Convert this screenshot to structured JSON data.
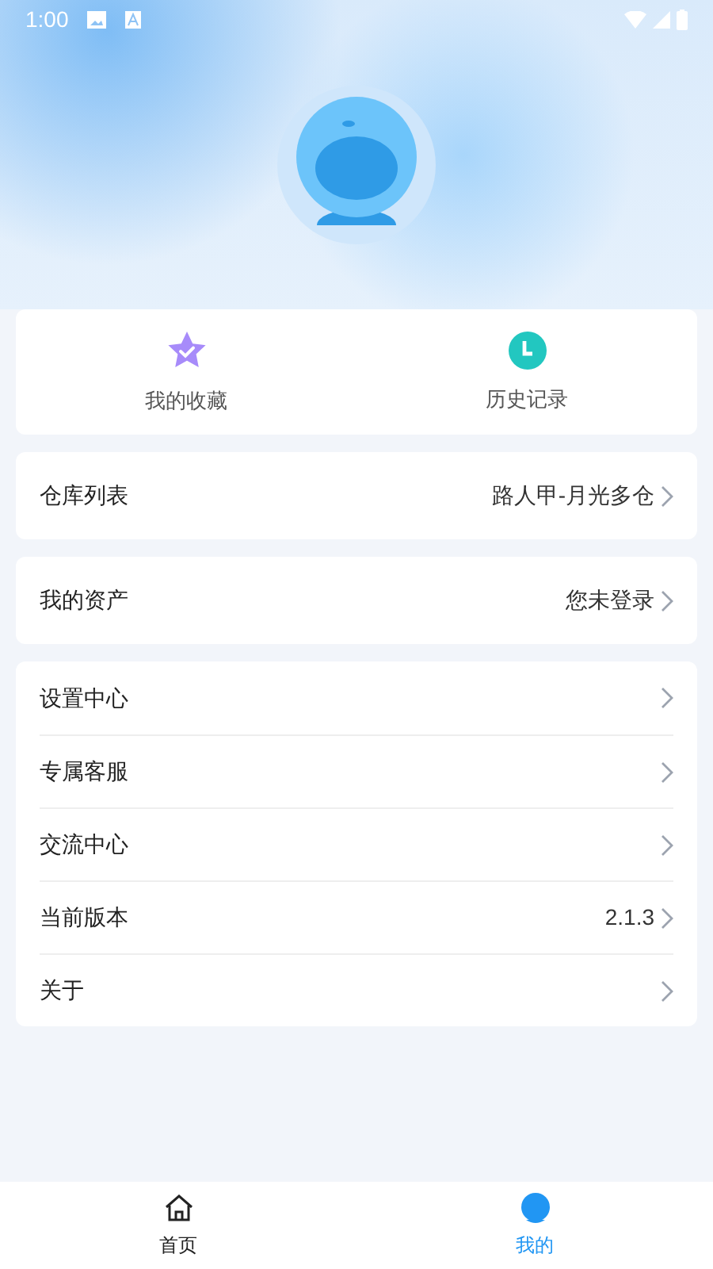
{
  "status_bar": {
    "time": "1:00"
  },
  "shortcuts": [
    {
      "label": "我的收藏",
      "kind": "favorites"
    },
    {
      "label": "历史记录",
      "kind": "history"
    }
  ],
  "menu_groups": [
    [
      {
        "label": "仓库列表",
        "value": "路人甲-月光多仓"
      }
    ],
    [
      {
        "label": "我的资产",
        "value": "您未登录"
      }
    ],
    [
      {
        "label": "设置中心"
      },
      {
        "label": "专属客服"
      },
      {
        "label": "交流中心"
      },
      {
        "label": "当前版本",
        "value": "2.1.3"
      },
      {
        "label": "关于"
      }
    ]
  ],
  "bottom_nav": [
    {
      "label": "首页",
      "kind": "home",
      "selected": false
    },
    {
      "label": "我的",
      "kind": "profile",
      "selected": true
    }
  ]
}
